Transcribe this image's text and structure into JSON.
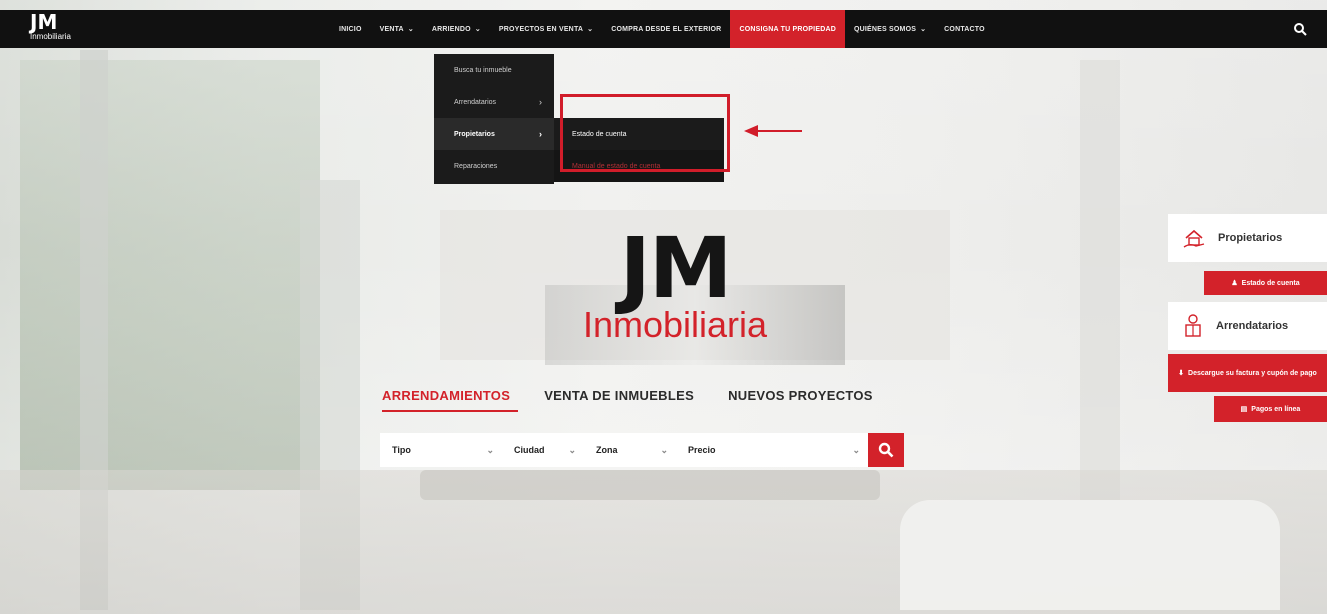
{
  "brand": {
    "logo_main": "JM",
    "logo_sub": "Inmobiliaria",
    "hero_logo_main": "JM",
    "hero_logo_sub": "Inmobiliaria",
    "accent_color": "#d3222a"
  },
  "nav": {
    "items": [
      {
        "label": "INICIO"
      },
      {
        "label": "VENTA",
        "chevron": "⌄"
      },
      {
        "label": "ARRIENDO",
        "chevron": "⌄"
      },
      {
        "label": "PROYECTOS EN VENTA",
        "chevron": "⌄"
      },
      {
        "label": "COMPRA DESDE EL EXTERIOR"
      },
      {
        "label": "CONSIGNA TU PROPIEDAD"
      },
      {
        "label": "QUIÉNES SOMOS",
        "chevron": "⌄"
      },
      {
        "label": "CONTACTO"
      }
    ],
    "search_icon": "search-icon"
  },
  "dropdown": {
    "items": [
      {
        "label": "Busca tu inmueble"
      },
      {
        "label": "Arrendatarios",
        "arrow": "›"
      },
      {
        "label": "Propietarios",
        "arrow": "›"
      },
      {
        "label": "Reparaciones"
      }
    ]
  },
  "submenu": {
    "items": [
      {
        "label": "Estado de cuenta"
      },
      {
        "label": "Manual de estado de cuenta"
      }
    ]
  },
  "search_tabs": [
    {
      "label": "ARRENDAMIENTOS"
    },
    {
      "label": "VENTA DE INMUEBLES"
    },
    {
      "label": "NUEVOS PROYECTOS"
    }
  ],
  "search": {
    "tipo": "Tipo",
    "ciudad": "Ciudad",
    "zona": "Zona",
    "precio": "Precio",
    "caret": "⌄"
  },
  "side_panel": {
    "propietarios_title": "Propietarios",
    "estado_cuenta": "Estado de cuenta",
    "arrendatarios_title": "Arrendatarios",
    "descargue": "Descargue su factura y cupón de pago",
    "pagos": "Pagos en línea"
  }
}
